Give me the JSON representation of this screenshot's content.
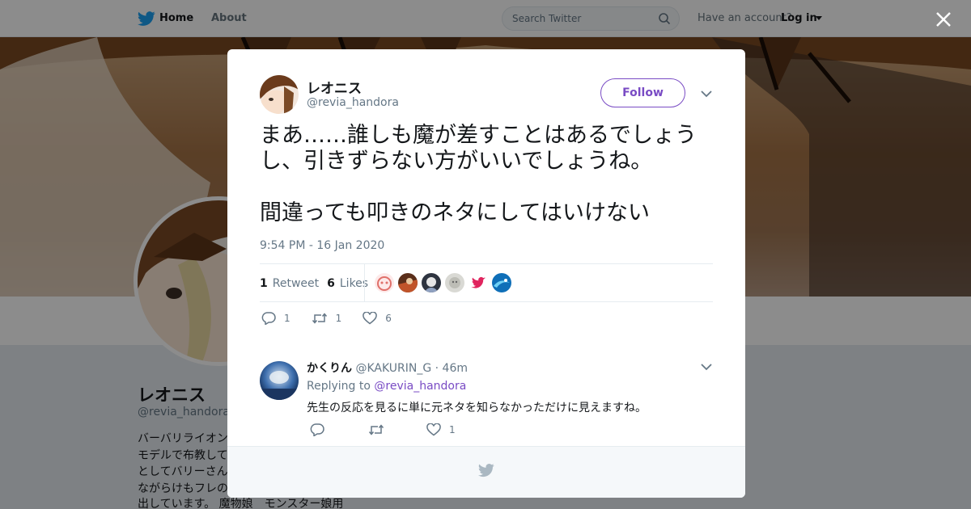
{
  "topbar": {
    "home_label": "Home",
    "about_label": "About",
    "search_placeholder": "Search Twitter",
    "account_prompt": "Have an account?",
    "login_label": "Log in"
  },
  "profile": {
    "name": "レオニス",
    "handle": "@revia_handora",
    "bio_lines": [
      "バーバリライオン",
      "モデルで布教して",
      "としてバリーさん",
      "ながらけもフレの"
    ],
    "bio_last": "出しています。 魔物娘　モンスター娘用"
  },
  "tweet": {
    "author_name": "レオニス",
    "author_handle": "@revia_handora",
    "follow_label": "Follow",
    "text": "まあ……誰しも魔が差すことはあるでしょうし、引きずらない方がいいでしょうね。\n\n間違っても叩きのネタにしてはいけない",
    "timestamp": "9:54 PM - 16 Jan 2020",
    "retweet_count": "1",
    "retweet_label": "Retweet",
    "like_count": "6",
    "like_label": "Likes",
    "actions": {
      "reply": "1",
      "retweet": "1",
      "like": "6"
    }
  },
  "reply": {
    "name": "かくりん",
    "handle": "@KAKURIN_G",
    "time": "· 46m",
    "replying_label": "Replying to",
    "replying_handle": "@revia_handora",
    "text": "先生の反応を見るに単に元ネタを知らなかっただけに見えますね。",
    "actions": {
      "reply": "",
      "retweet": "",
      "like": "1"
    }
  },
  "colors": {
    "accent": "#794bc4",
    "twitter_blue": "#1da1f2",
    "muted": "#657786"
  }
}
